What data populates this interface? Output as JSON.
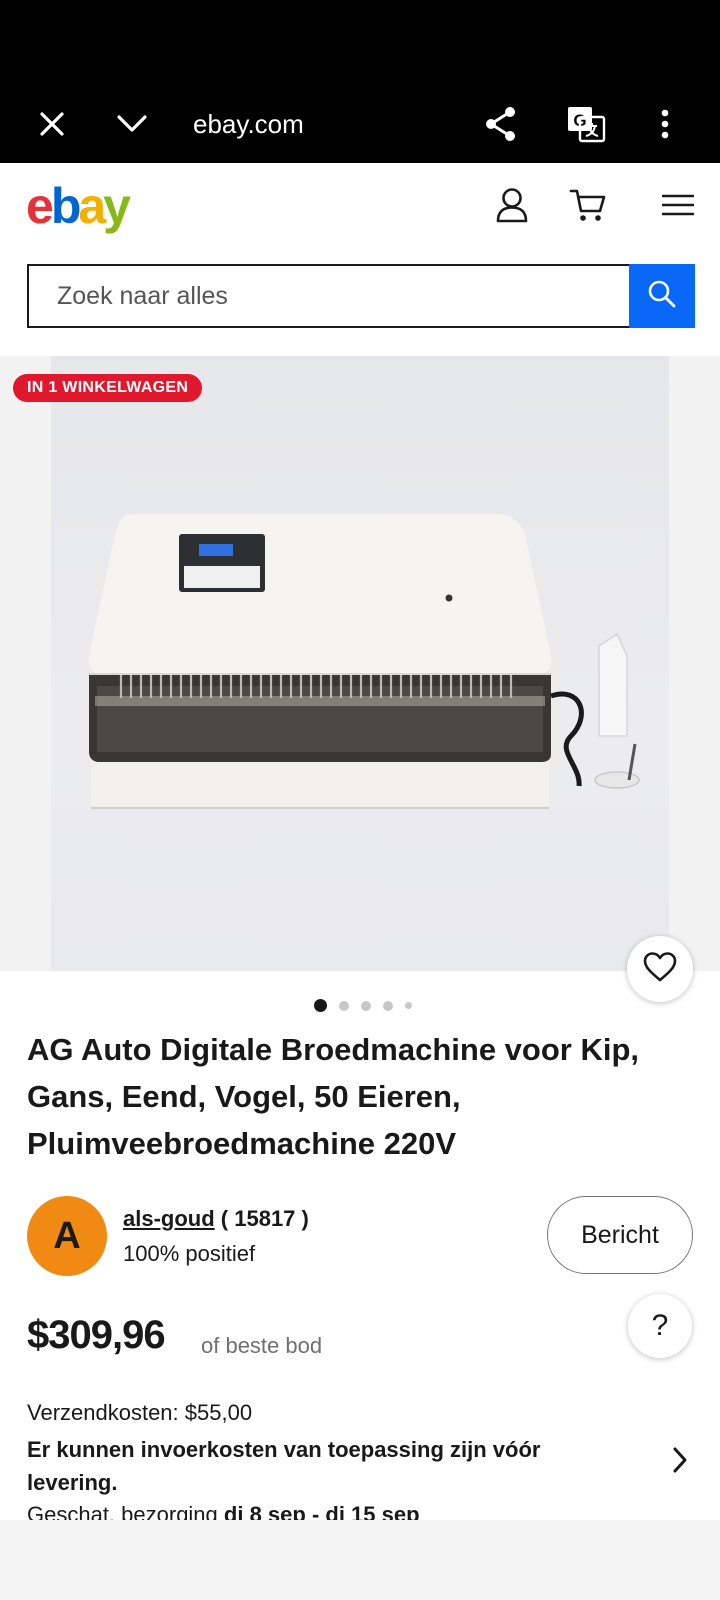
{
  "browser": {
    "url": "ebay.com",
    "icons": [
      "close-icon",
      "chevron-down-icon",
      "share-icon",
      "translate-icon",
      "more-icon"
    ]
  },
  "header": {
    "logo_letters": [
      "e",
      "b",
      "a",
      "y"
    ],
    "logo_colors": [
      "#e53238",
      "#0064d2",
      "#f5af02",
      "#86b817"
    ],
    "icons": [
      "account-icon",
      "cart-icon",
      "menu-icon"
    ]
  },
  "search": {
    "placeholder": "Zoek naar alles",
    "button_color": "#0968f6"
  },
  "gallery": {
    "badge": "IN 1 WINKELWAGEN",
    "image_count": 5,
    "active_index": 0
  },
  "listing": {
    "title": "AG Auto Digitale Broedmachine voor Kip, Gans, Eend, Vogel, 50 Eieren, Pluimveebroedmachine 220V"
  },
  "seller": {
    "initial": "A",
    "name": "als-goud",
    "feedback_count": "( 15817 )",
    "positive": "100% positief",
    "message_label": "Bericht"
  },
  "pricing": {
    "price": "$309,96",
    "best_offer": "of beste bod",
    "help_label": "?"
  },
  "shipping": {
    "cost": "Verzendkosten: $55,00",
    "import_note": "Er kunnen invoerkosten van toepassing zijn vóór levering.",
    "delivery_prefix": "Geschat. bezorging",
    "delivery_dates": "di 8 sep - di 15 sep"
  }
}
